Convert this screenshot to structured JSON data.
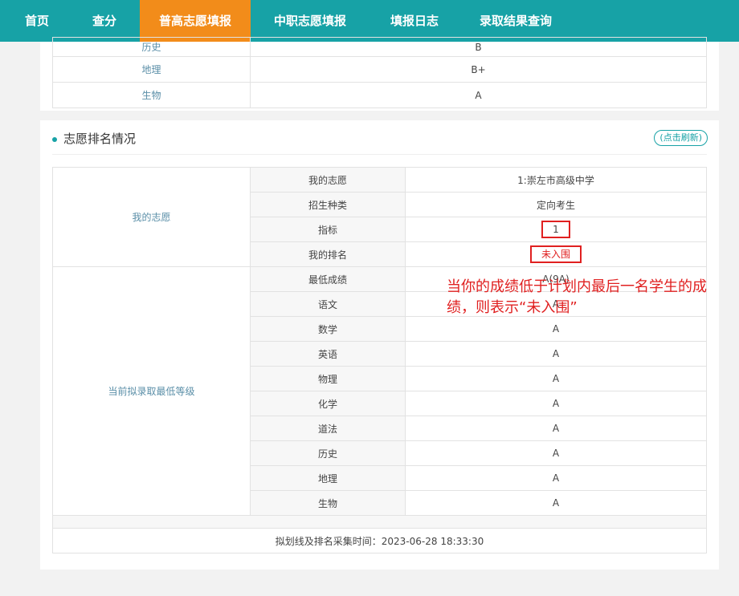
{
  "nav": {
    "items": [
      {
        "label": "首页"
      },
      {
        "label": "查分"
      },
      {
        "label": "普高志愿填报"
      },
      {
        "label": "中职志愿填报"
      },
      {
        "label": "填报日志"
      },
      {
        "label": "录取结果查询"
      }
    ]
  },
  "top_table": {
    "rows": [
      {
        "subject": "历史",
        "grade": "B"
      },
      {
        "subject": "地理",
        "grade": "B+"
      },
      {
        "subject": "生物",
        "grade": "A"
      }
    ]
  },
  "ranking": {
    "title": "志愿排名情况",
    "refresh_label": "(点击刷新)",
    "my_choice_group": "我的志愿",
    "min_grade_group": "当前拟录取最低等级",
    "rows": [
      {
        "label": "我的志愿",
        "value": "1:崇左市高级中学"
      },
      {
        "label": "招生种类",
        "value": "定向考生"
      },
      {
        "label": "指标",
        "value": "1"
      },
      {
        "label": "我的排名",
        "value": "未入围"
      },
      {
        "label": "最低成绩",
        "value": "A(9A)"
      },
      {
        "label": "语文",
        "value": "A"
      },
      {
        "label": "数学",
        "value": "A"
      },
      {
        "label": "英语",
        "value": "A"
      },
      {
        "label": "物理",
        "value": "A"
      },
      {
        "label": "化学",
        "value": "A"
      },
      {
        "label": "道法",
        "value": "A"
      },
      {
        "label": "历史",
        "value": "A"
      },
      {
        "label": "地理",
        "value": "A"
      },
      {
        "label": "生物",
        "value": "A"
      }
    ],
    "footer": "拟划线及排名采集时间：2023-06-28 18:33:30"
  },
  "annotation": "当你的成绩低于计划内最后一名学生的成绩，则表示“未入围”",
  "colors": {
    "nav": "#17a2a6",
    "active": "#f28c1a",
    "highlight": "#e02020"
  }
}
